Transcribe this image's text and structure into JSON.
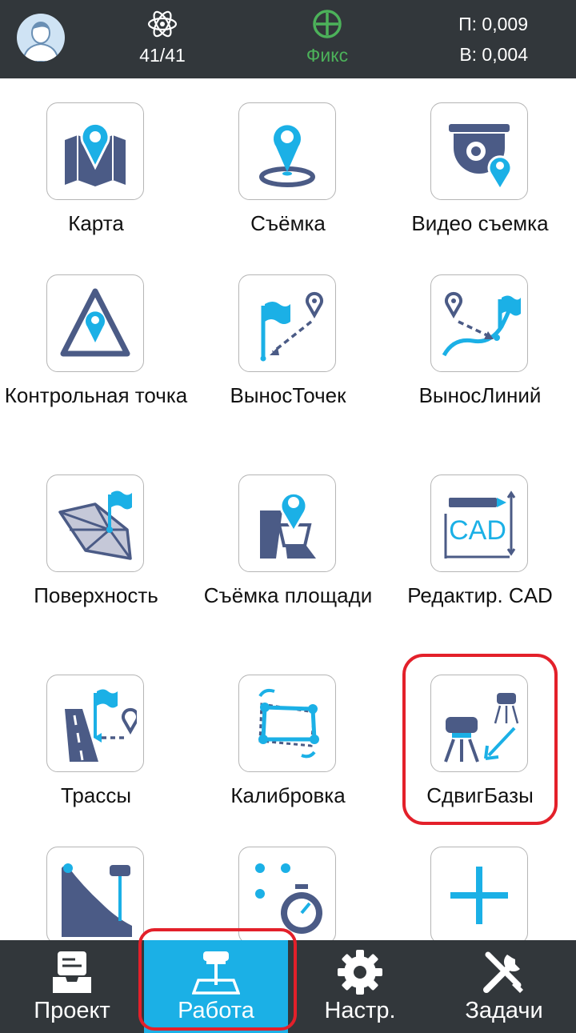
{
  "status": {
    "satellites": "41/41",
    "fix_status": "Фикс",
    "precision_h": "П: 0,009",
    "precision_v": "В: 0,004",
    "icons": {
      "avatar": "user-avatar-icon",
      "satellites": "atom-satellite-icon",
      "fix": "crosshair-icon"
    }
  },
  "tiles": [
    {
      "label": "Карта",
      "icon": "map-pin-icon"
    },
    {
      "label": "Съёмка",
      "icon": "survey-pin-icon"
    },
    {
      "label": "Видео съемка",
      "icon": "video-camera-icon"
    },
    {
      "label": "Контрольная точка",
      "icon": "control-point-icon"
    },
    {
      "label": "ВыносТочек",
      "icon": "stakeout-points-icon"
    },
    {
      "label": "ВыносЛиний",
      "icon": "stakeout-lines-icon"
    },
    {
      "label": "Поверхность",
      "icon": "surface-icon"
    },
    {
      "label": "Съёмка площади",
      "icon": "area-survey-icon"
    },
    {
      "label": "Редактир. CAD",
      "icon": "cad-icon",
      "icon_text": "CAD"
    },
    {
      "label": "Трассы",
      "icon": "road-icon"
    },
    {
      "label": "Калибровка",
      "icon": "calibration-icon"
    },
    {
      "label": "СдвигБазы",
      "icon": "base-shift-icon"
    },
    {
      "label": "",
      "icon": "slope-receiver-icon"
    },
    {
      "label": "",
      "icon": "timer-icon"
    },
    {
      "label": "",
      "icon": "plus-icon"
    }
  ],
  "nav": {
    "items": [
      {
        "label": "Проект",
        "icon": "project-tray-icon"
      },
      {
        "label": "Работа",
        "icon": "work-receiver-icon"
      },
      {
        "label": "Настр.",
        "icon": "gear-icon"
      },
      {
        "label": "Задачи",
        "icon": "tools-icon"
      }
    ],
    "active": "Работа"
  },
  "colors": {
    "statusbar_bg": "#32373b",
    "accent_blue": "#1bb0e6",
    "icon_navy": "#4b5b86",
    "fix_green": "#4cb25a",
    "highlight_red": "#e3202a"
  }
}
